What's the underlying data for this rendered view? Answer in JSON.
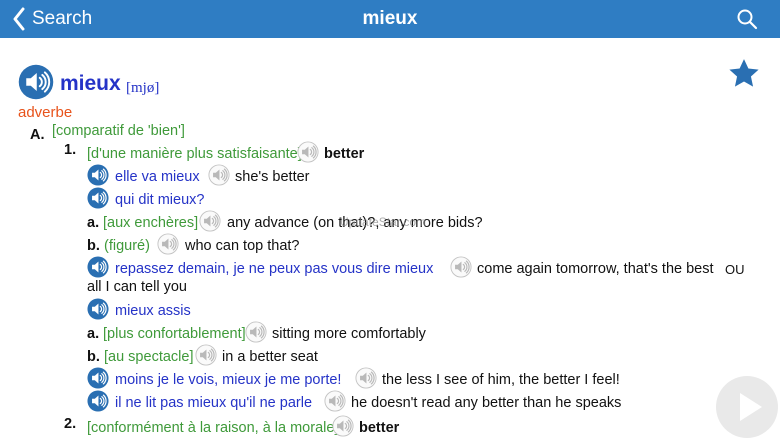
{
  "header": {
    "back_label": "Search",
    "title": "mieux"
  },
  "entry": {
    "headword": "mieux",
    "pronunciation": "[mjø]",
    "pos": "adverbe"
  },
  "sections": {
    "A": {
      "letter": "A.",
      "gloss": "[comparatif de 'bien']"
    },
    "s1": {
      "number": "1.",
      "gloss": "[d'une manière plus satisfaisante]",
      "translation": "better"
    },
    "ex1": {
      "fr": "elle va mieux",
      "en": "she's better"
    },
    "ex2": {
      "fr": "qui dit mieux?"
    },
    "a1": {
      "letter": "a.",
      "gloss": "[aux enchères]",
      "en": "any advance (on that)?, any more bids?"
    },
    "b1": {
      "letter": "b.",
      "gloss": "(figuré)",
      "en": "who can top that?"
    },
    "ex3": {
      "fr": "repassez demain, je ne peux pas vous dire mieux",
      "en": "come again tomorrow, that's the best",
      "ou": "OU",
      "en2": "all I can tell you"
    },
    "ex4": {
      "fr": "mieux assis"
    },
    "a2": {
      "letter": "a.",
      "gloss": "[plus confortablement]",
      "en": "sitting more comfortably"
    },
    "b2": {
      "letter": "b.",
      "gloss": "[au spectacle]",
      "en": "in a better seat"
    },
    "ex5": {
      "fr": "moins je le vois, mieux je me porte!",
      "en": "the less I see of him, the better I feel!"
    },
    "ex6": {
      "fr": "il ne lit pas mieux qu'il ne parle",
      "en": "he doesn't read any better than he speaks"
    },
    "s2": {
      "number": "2.",
      "gloss": "[conformément à la raison, à la morale]",
      "translation": "better"
    }
  },
  "watermark": "UpdateStar.com",
  "icons": {
    "back": "chevron-left-icon",
    "search": "magnifier-icon",
    "favorite": "star-icon",
    "audio": "speaker-icon",
    "play": "play-icon"
  },
  "colors": {
    "topbar": "#2f7dc3",
    "link_blue": "#2533c7",
    "gloss_green": "#3f9a3a",
    "pos_orange": "#e8531b",
    "speaker_blue": "#2a6fb2",
    "speaker_gray": "#b9b9b9"
  }
}
